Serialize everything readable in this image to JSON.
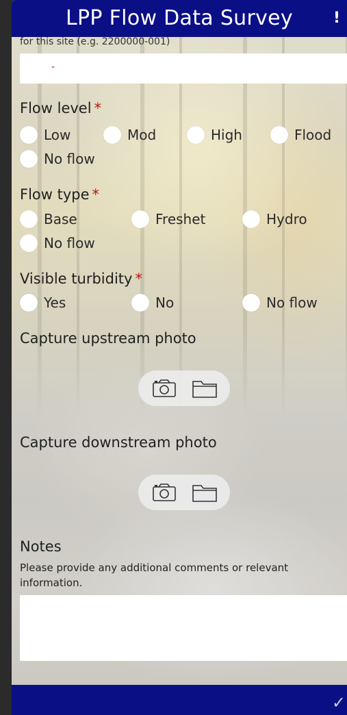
{
  "header": {
    "title": "LPP Flow Data Survey",
    "alert_glyph": "!"
  },
  "site_field": {
    "hint": "for this site (e.g. 2200000-001)",
    "value": "-"
  },
  "flow_level": {
    "label": "Flow level",
    "required_mark": "*",
    "options": [
      "Low",
      "Mod",
      "High",
      "Flood",
      "No flow"
    ]
  },
  "flow_type": {
    "label": "Flow type",
    "required_mark": "*",
    "options": [
      "Base",
      "Freshet",
      "Hydro",
      "No flow"
    ]
  },
  "turbidity": {
    "label": "Visible turbidity",
    "required_mark": "*",
    "options": [
      "Yes",
      "No",
      "No flow"
    ]
  },
  "upstream_photo": {
    "label": "Capture upstream photo",
    "icons": [
      "camera-icon",
      "folder-icon"
    ]
  },
  "downstream_photo": {
    "label": "Capture downstream photo",
    "icons": [
      "camera-icon",
      "folder-icon"
    ]
  },
  "notes": {
    "label": "Notes",
    "hint_line1": "Please provide any additional comments or relevant",
    "hint_line2": "information.",
    "value": ""
  },
  "footer": {
    "submit_glyph": "✓"
  },
  "colors": {
    "header_bar": "#0b0f86",
    "required": "#c21010"
  }
}
